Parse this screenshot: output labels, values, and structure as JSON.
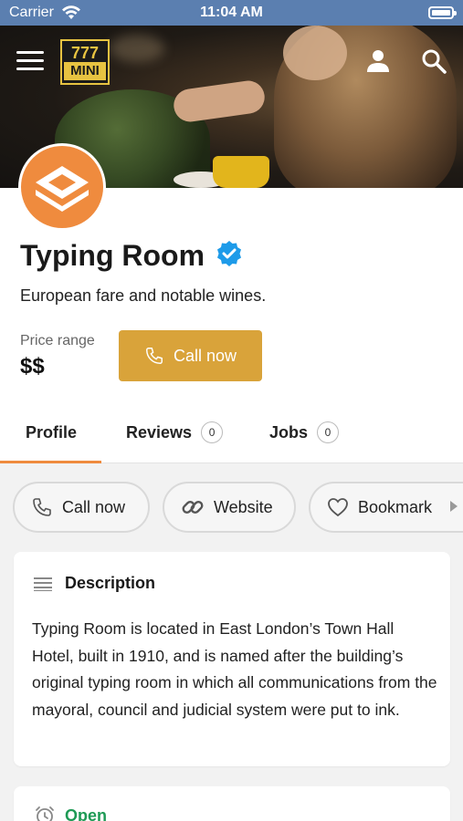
{
  "status_bar": {
    "carrier": "Carrier",
    "time": "11:04 AM"
  },
  "nav": {
    "brand_top": "777",
    "brand_bottom": "MINI"
  },
  "venue": {
    "name": "Typing Room",
    "tagline": "European fare and notable wines.",
    "price_label": "Price range",
    "price_value": "$$",
    "call_button": "Call now",
    "avatar_color": "#ef8b3e",
    "accent_color": "#d9a33a"
  },
  "tabs": [
    {
      "label": "Profile"
    },
    {
      "label": "Reviews",
      "count": "0"
    },
    {
      "label": "Jobs",
      "count": "0"
    }
  ],
  "chips": {
    "call": "Call now",
    "website": "Website",
    "bookmark": "Bookmark"
  },
  "description": {
    "heading": "Description",
    "text": "Typing Room is located in East London’s Town Hall Hotel, built in 1910, and is named after the building’s original typing room in which all communications from the mayoral, council and judicial system were put to ink."
  },
  "hours": {
    "status": "Open",
    "status_color": "#1e9a55"
  }
}
